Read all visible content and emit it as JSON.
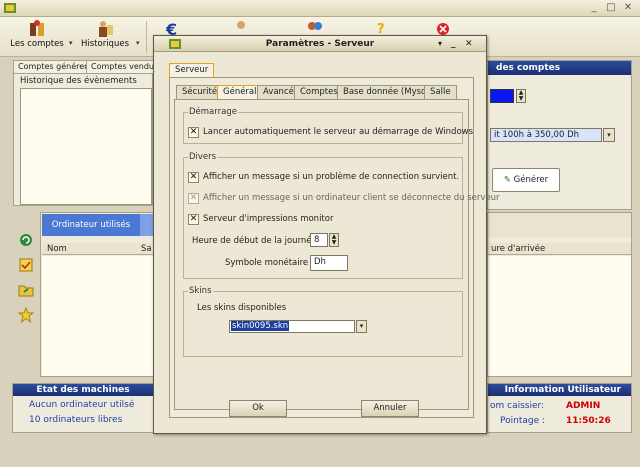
{
  "window": {
    "minimize": "_",
    "maximize": "□",
    "close": "✕"
  },
  "toolbar": {
    "comptes": "Les comptes",
    "historiques": "Historiques"
  },
  "left": {
    "tabs": [
      "Comptes générer",
      "Comptes vendu"
    ],
    "historique_title": "Historique des évènements",
    "ordi_tab": "Ordinateur utilisés",
    "col_nom": "Nom",
    "col_s": "Sa"
  },
  "right": {
    "title": "des comptes",
    "select_value": "it 100h à 350,00 Dh",
    "generate_btn": "Générer",
    "col_arrivee": "ure d'arrivée"
  },
  "status_machines": {
    "title": "Etat des machines",
    "line1": "Aucun ordinateur utilsé",
    "line2": "10 ordinateurs libres"
  },
  "status_user": {
    "title": "Information Utilisateur",
    "caissier_label": "om caissier:",
    "caissier_value": "ADMIN",
    "pointage_label": "Pointage :",
    "pointage_value": "11:50:26"
  },
  "dialog": {
    "title": "Paramètres - Serveur",
    "outer_tab": "Serveur",
    "tabs": [
      "Sécurité",
      "Général",
      "Avancé",
      "Comptes",
      "Base donnée (Mysql)",
      "Salle"
    ],
    "active_tab": "Général",
    "demarrage": {
      "title": "Démarrage",
      "auto_start": "Lancer automatiquement le serveur au démarrage de Windows"
    },
    "divers": {
      "title": "Divers",
      "opt1": "Afficher un message si un problème de connection survient.",
      "opt2": "Afficher un message si un ordinateur client se déconnecte du serveur",
      "opt3": "Serveur d'impressions monitor",
      "heure_label": "Heure de début de la journée :",
      "heure_value": "8",
      "symbole_label": "Symbole monétaire :",
      "symbole_value": "Dh"
    },
    "skins": {
      "title": "Skins",
      "available_label": "Les skins disponibles",
      "selected": "skin0095.skn"
    },
    "ok": "Ok",
    "cancel": "Annuler"
  },
  "colors": {
    "accent_orange": "#e8a11b",
    "header_blue": "#1c2f73",
    "alert_red": "#d00000"
  }
}
